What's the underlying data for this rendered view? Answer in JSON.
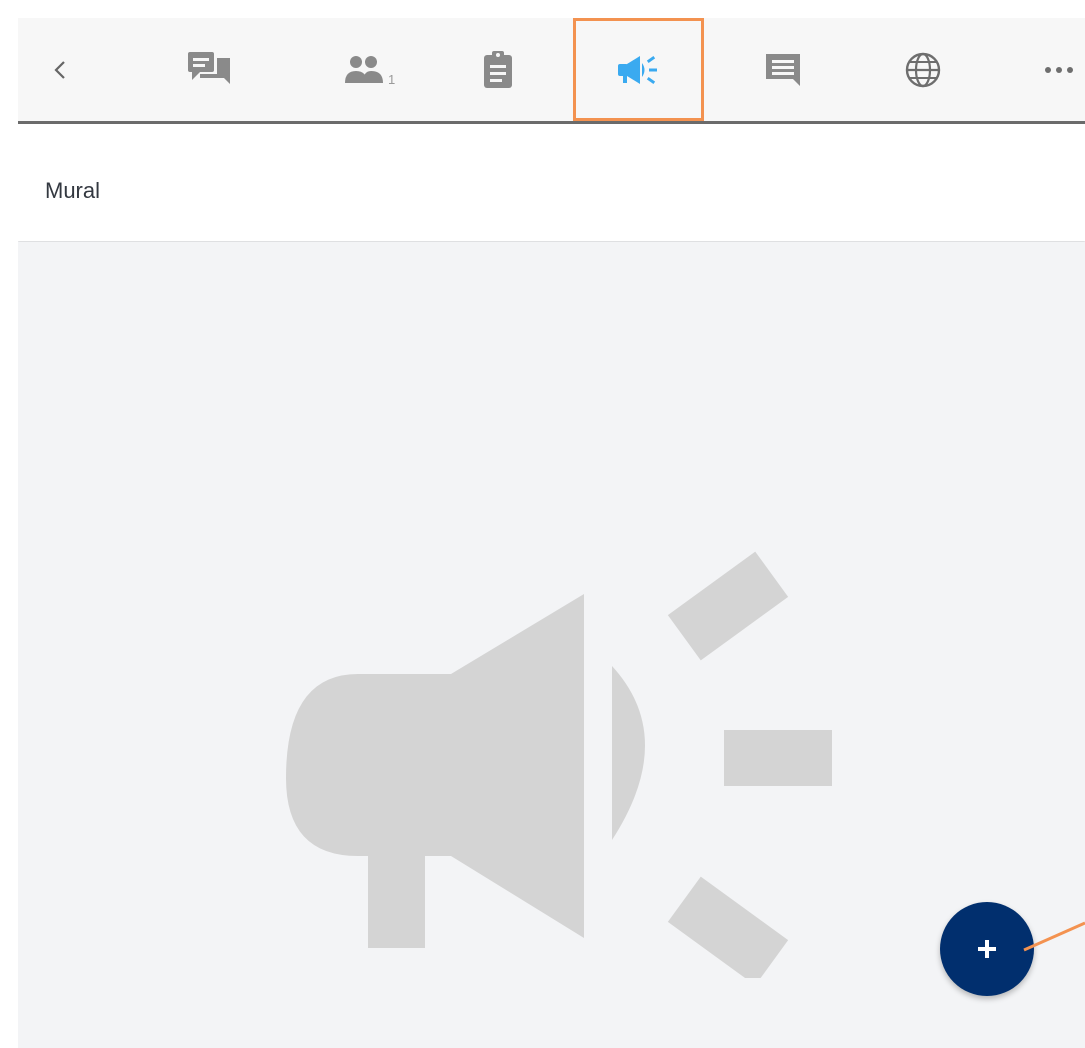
{
  "toolbar": {
    "items": [
      {
        "name": "back",
        "icon": "chevron-left-icon"
      },
      {
        "name": "conversations",
        "icon": "forum-icon"
      },
      {
        "name": "members",
        "icon": "people-icon",
        "count": "1"
      },
      {
        "name": "tasks",
        "icon": "clipboard-icon"
      },
      {
        "name": "mural",
        "icon": "megaphone-icon",
        "active": true
      },
      {
        "name": "posts",
        "icon": "message-icon"
      },
      {
        "name": "web",
        "icon": "globe-icon"
      },
      {
        "name": "more",
        "icon": "more-horizontal-icon"
      }
    ]
  },
  "header": {
    "title": "Mural"
  },
  "empty_state": {
    "icon": "megaphone-icon"
  },
  "fab": {
    "icon": "plus-icon",
    "label": "+"
  },
  "colors": {
    "accent_active": "#3aaaf0",
    "icon_default": "#8a8a8a",
    "highlight": "#f39250",
    "fab": "#012f6e",
    "illustration": "#d4d4d4"
  }
}
